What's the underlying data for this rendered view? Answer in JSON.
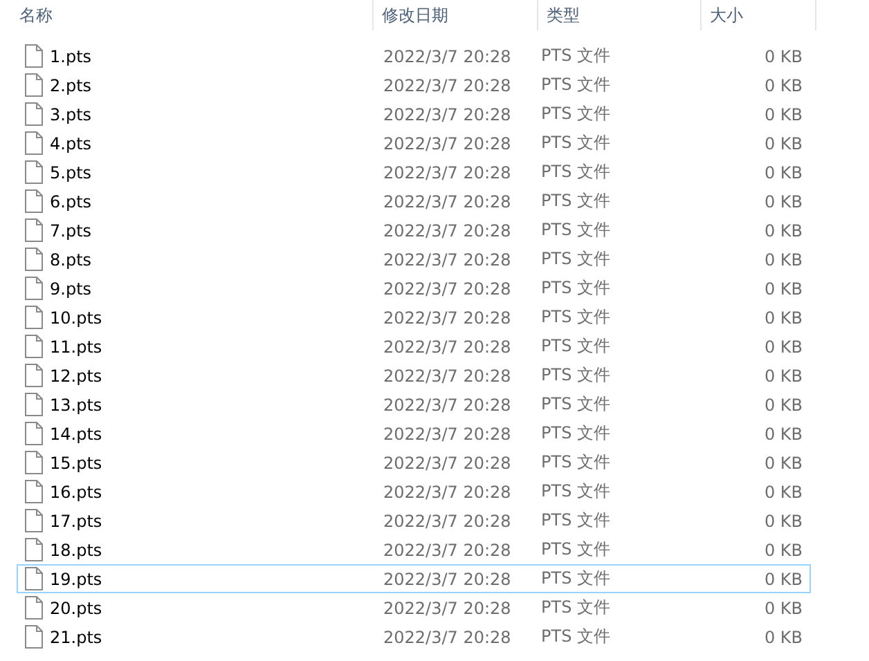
{
  "columns": [
    {
      "label": "名称"
    },
    {
      "label": "修改日期"
    },
    {
      "label": "类型"
    },
    {
      "label": "大小"
    }
  ],
  "rows": [
    {
      "name": "1.pts",
      "date": "2022/3/7 20:28",
      "type": "PTS 文件",
      "size": "0 KB",
      "focused": false
    },
    {
      "name": "2.pts",
      "date": "2022/3/7 20:28",
      "type": "PTS 文件",
      "size": "0 KB",
      "focused": false
    },
    {
      "name": "3.pts",
      "date": "2022/3/7 20:28",
      "type": "PTS 文件",
      "size": "0 KB",
      "focused": false
    },
    {
      "name": "4.pts",
      "date": "2022/3/7 20:28",
      "type": "PTS 文件",
      "size": "0 KB",
      "focused": false
    },
    {
      "name": "5.pts",
      "date": "2022/3/7 20:28",
      "type": "PTS 文件",
      "size": "0 KB",
      "focused": false
    },
    {
      "name": "6.pts",
      "date": "2022/3/7 20:28",
      "type": "PTS 文件",
      "size": "0 KB",
      "focused": false
    },
    {
      "name": "7.pts",
      "date": "2022/3/7 20:28",
      "type": "PTS 文件",
      "size": "0 KB",
      "focused": false
    },
    {
      "name": "8.pts",
      "date": "2022/3/7 20:28",
      "type": "PTS 文件",
      "size": "0 KB",
      "focused": false
    },
    {
      "name": "9.pts",
      "date": "2022/3/7 20:28",
      "type": "PTS 文件",
      "size": "0 KB",
      "focused": false
    },
    {
      "name": "10.pts",
      "date": "2022/3/7 20:28",
      "type": "PTS 文件",
      "size": "0 KB",
      "focused": false
    },
    {
      "name": "11.pts",
      "date": "2022/3/7 20:28",
      "type": "PTS 文件",
      "size": "0 KB",
      "focused": false
    },
    {
      "name": "12.pts",
      "date": "2022/3/7 20:28",
      "type": "PTS 文件",
      "size": "0 KB",
      "focused": false
    },
    {
      "name": "13.pts",
      "date": "2022/3/7 20:28",
      "type": "PTS 文件",
      "size": "0 KB",
      "focused": false
    },
    {
      "name": "14.pts",
      "date": "2022/3/7 20:28",
      "type": "PTS 文件",
      "size": "0 KB",
      "focused": false
    },
    {
      "name": "15.pts",
      "date": "2022/3/7 20:28",
      "type": "PTS 文件",
      "size": "0 KB",
      "focused": false
    },
    {
      "name": "16.pts",
      "date": "2022/3/7 20:28",
      "type": "PTS 文件",
      "size": "0 KB",
      "focused": false
    },
    {
      "name": "17.pts",
      "date": "2022/3/7 20:28",
      "type": "PTS 文件",
      "size": "0 KB",
      "focused": false
    },
    {
      "name": "18.pts",
      "date": "2022/3/7 20:28",
      "type": "PTS 文件",
      "size": "0 KB",
      "focused": false
    },
    {
      "name": "19.pts",
      "date": "2022/3/7 20:28",
      "type": "PTS 文件",
      "size": "0 KB",
      "focused": true
    },
    {
      "name": "20.pts",
      "date": "2022/3/7 20:28",
      "type": "PTS 文件",
      "size": "0 KB",
      "focused": false
    },
    {
      "name": "21.pts",
      "date": "2022/3/7 20:28",
      "type": "PTS 文件",
      "size": "0 KB",
      "focused": false
    }
  ]
}
